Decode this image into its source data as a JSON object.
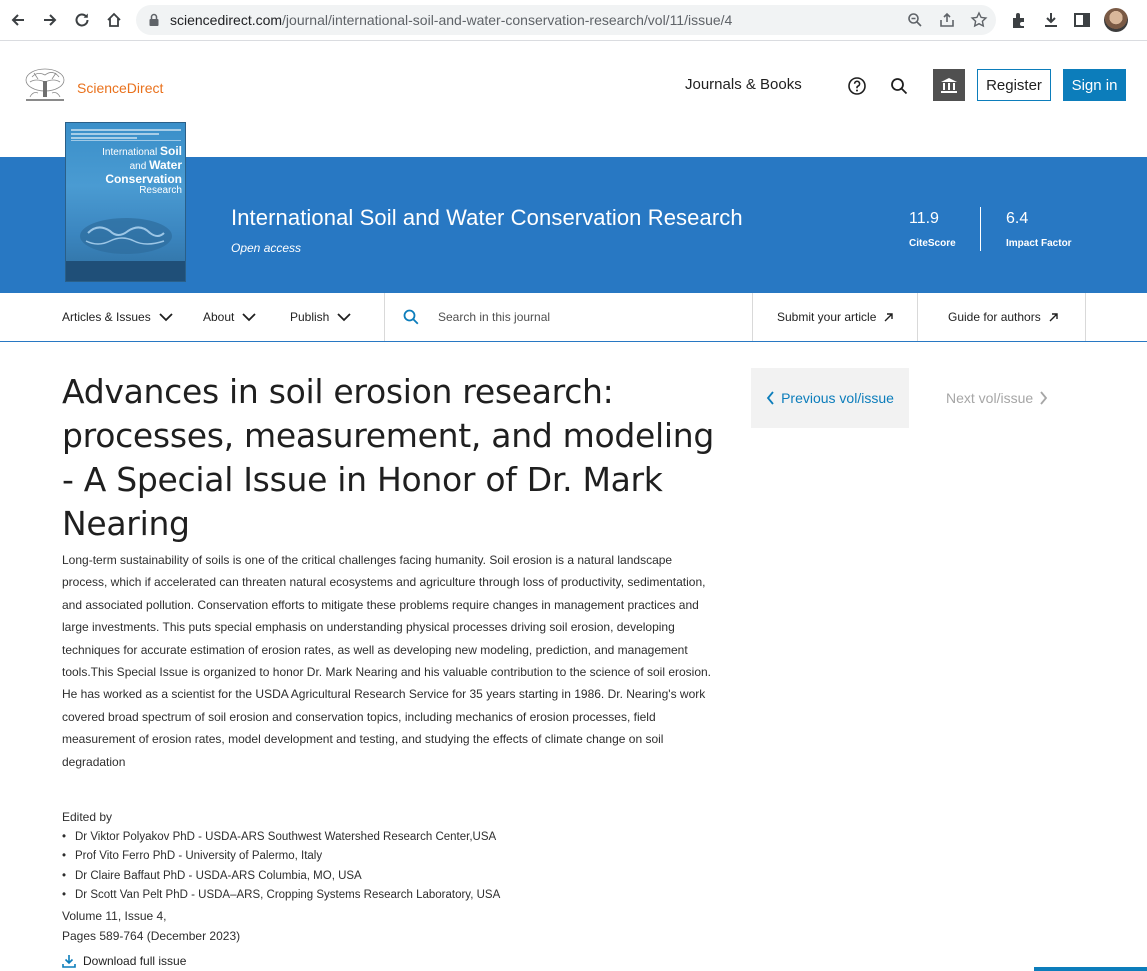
{
  "browser": {
    "url_host": "sciencedirect.com",
    "url_path": "/journal/international-soil-and-water-conservation-research/vol/11/issue/4"
  },
  "header": {
    "logo_text": "ScienceDirect",
    "journals_link": "Journals & Books",
    "register_label": "Register",
    "signin_label": "Sign in"
  },
  "banner": {
    "cover": {
      "line1": "International",
      "line1_bold": "Soil",
      "line2": "and",
      "line2_bold": "Water",
      "line3": "Conservation",
      "line4": "Research"
    },
    "journal_title": "International Soil and Water Conservation Research",
    "access": "Open access",
    "metrics": [
      {
        "value": "11.9",
        "label": "CiteScore"
      },
      {
        "value": "6.4",
        "label": "Impact Factor"
      }
    ]
  },
  "journal_nav": {
    "articles_issues": "Articles & Issues",
    "about": "About",
    "publish": "Publish",
    "search_placeholder": "Search in this journal",
    "submit": "Submit your article",
    "guide": "Guide for authors"
  },
  "issue": {
    "title": "Advances in soil erosion research: processes, measurement, and modeling - A Special Issue in Honor of Dr. Mark Nearing",
    "description": "Long-term sustainability of soils is one of the critical challenges facing humanity. Soil erosion is a natural landscape process, which if accelerated can threaten natural ecosystems and agriculture through loss of productivity, sedimentation, and associated pollution. Conservation efforts to mitigate these problems require changes in management practices and large investments. This puts special emphasis on understanding physical processes driving soil erosion, developing techniques for accurate estimation of erosion rates, as well as developing new modeling, prediction, and management tools.This Special Issue is organized to honor Dr. Mark Nearing and his valuable contribution to the science of soil erosion. He has worked as a scientist for the USDA Agricultural Research Service for 35 years starting in 1986. Dr. Nearing's work covered broad spectrum of soil erosion and conservation topics, including mechanics of erosion processes, field measurement of erosion rates, model development and testing, and studying the effects of climate change on soil degradation",
    "edited_by_label": "Edited by",
    "editors": [
      "Dr Viktor Polyakov PhD - USDA-ARS Southwest Watershed Research Center,USA",
      "Prof Vito Ferro PhD - University of Palermo, Italy",
      "Dr Claire Baffaut PhD - USDA-ARS Columbia, MO, USA",
      "Dr Scott Van Pelt PhD - USDA–ARS, Cropping Systems Research Laboratory, USA"
    ],
    "volume": "Volume 11, Issue 4,",
    "pages": "Pages 589-764 (December 2023)",
    "download_label": "Download full issue"
  },
  "issue_nav": {
    "previous": "Previous vol/issue",
    "next": "Next vol/issue"
  },
  "colors": {
    "brand_blue": "#2878c3",
    "link_blue": "#0c7dbb",
    "logo_orange": "#e9711c"
  }
}
